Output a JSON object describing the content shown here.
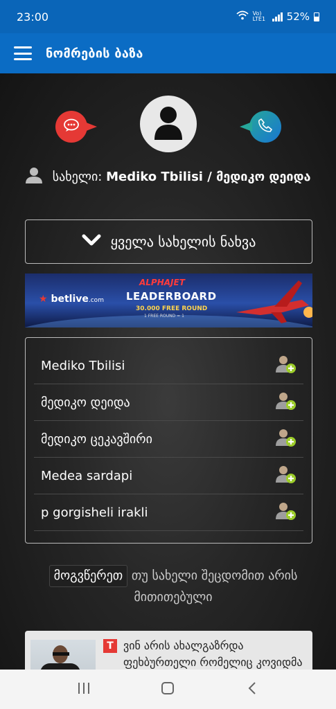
{
  "status": {
    "time": "23:00",
    "network": "Vo) LTE1",
    "battery": "52%"
  },
  "app": {
    "title": "ნომრების ბაზა"
  },
  "profile": {
    "name_label": "სახელი:",
    "name_value": "Mediko Tbilisi / მედიკო დეიდა"
  },
  "show_all": {
    "label": "ყველა სახელის ნახვა"
  },
  "banner": {
    "brand": "betlive",
    "brand_suffix": ".com",
    "game": "ALPHAJET",
    "title": "LEADERBOARD",
    "prize": "30.000 FREE ROUND",
    "prize_note": "1 FREE ROUND = 1"
  },
  "names": [
    {
      "label": "Mediko Tbilisi"
    },
    {
      "label": "მედიკო დეიდა"
    },
    {
      "label": "მედიკო ცეკავშირი"
    },
    {
      "label": "Medea sardapi"
    },
    {
      "label": "p gorgisheli irakli"
    }
  ],
  "suggest": {
    "link": "მოგვწერეთ",
    "text": "თუ სახელი შეცდომით არის მითითებული"
  },
  "news": {
    "badge": "T",
    "headline": "ვინ არის ახალგაზრდა ფეხბურთელი რომელიც კოვიდმა"
  },
  "colors": {
    "header": "#0b6cc4",
    "status_bar": "#0a65b8",
    "message_bubble": "#e53935",
    "call_bubble": "#1e88a8",
    "add_contact_accent": "#9ccc2a"
  }
}
